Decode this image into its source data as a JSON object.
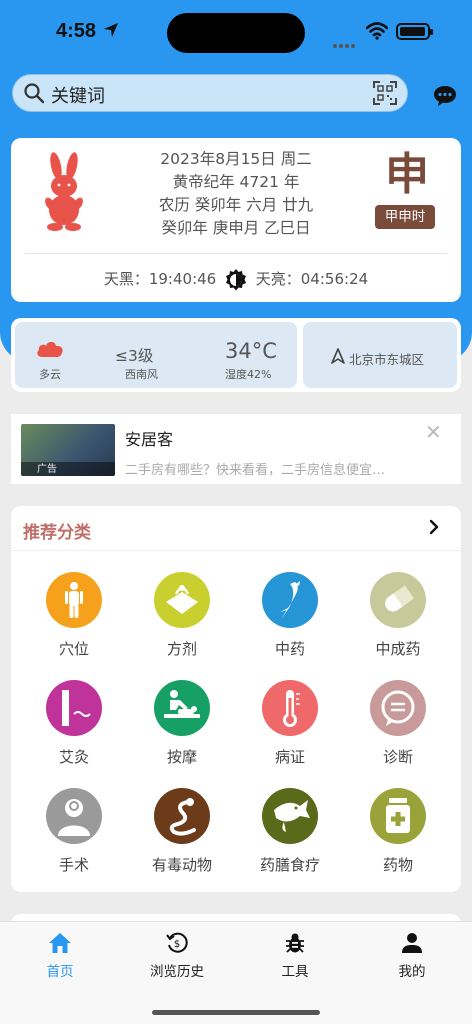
{
  "status": {
    "time": "4:58"
  },
  "search": {
    "placeholder": "关键词"
  },
  "date": {
    "line1": "2023年8月15日 周二",
    "line2": "黄帝纪年 4721 年",
    "line3": "农历 癸卯年 六月 廿九",
    "line4": "癸卯年 庚申月 乙巳日",
    "hour_char": "申",
    "hour_badge": "甲申时",
    "dusk": "天黑：19:40:46",
    "dawn": "天亮：04:56:24"
  },
  "weather": {
    "condition": "多云",
    "wind_level": "≤3级",
    "wind_dir": "西南风",
    "temp": "34°C",
    "humidity": "湿度42%",
    "city": "北京市东城区"
  },
  "ad": {
    "label": "广告",
    "title": "安居客",
    "desc": "二手房有哪些？快来看看，二手房信息便宜…"
  },
  "categories": {
    "title": "推荐分类",
    "items": [
      {
        "label": "穴位",
        "color": "#f5a11c",
        "icon": "acupoint-body-icon"
      },
      {
        "label": "方剂",
        "color": "#c9cf2e",
        "icon": "herb-package-icon"
      },
      {
        "label": "中药",
        "color": "#2595d6",
        "icon": "ginseng-root-icon"
      },
      {
        "label": "中成药",
        "color": "#c8c99a",
        "icon": "capsule-icon"
      },
      {
        "label": "艾灸",
        "color": "#c0339a",
        "icon": "moxa-stick-icon"
      },
      {
        "label": "按摩",
        "color": "#16a066",
        "icon": "massage-icon"
      },
      {
        "label": "病证",
        "color": "#f0696a",
        "icon": "thermometer-icon"
      },
      {
        "label": "诊断",
        "color": "#c89a9a",
        "icon": "speech-bubble-icon"
      },
      {
        "label": "手术",
        "color": "#9a9a9a",
        "icon": "surgeon-icon"
      },
      {
        "label": "有毒动物",
        "color": "#6b3b1a",
        "icon": "snake-icon"
      },
      {
        "label": "药膳食疗",
        "color": "#5a6a1a",
        "icon": "fish-icon"
      },
      {
        "label": "药物",
        "color": "#9aa23a",
        "icon": "medicine-bottle-icon"
      }
    ]
  },
  "tabs": [
    {
      "label": "首页",
      "icon": "home-icon",
      "active": true
    },
    {
      "label": "浏览历史",
      "icon": "history-icon",
      "active": false
    },
    {
      "label": "工具",
      "icon": "bug-icon",
      "active": false
    },
    {
      "label": "我的",
      "icon": "person-icon",
      "active": false
    }
  ],
  "colors": {
    "primary": "#2996f0",
    "rabbit": "#e8534a",
    "hour": "#7a4a3a"
  }
}
